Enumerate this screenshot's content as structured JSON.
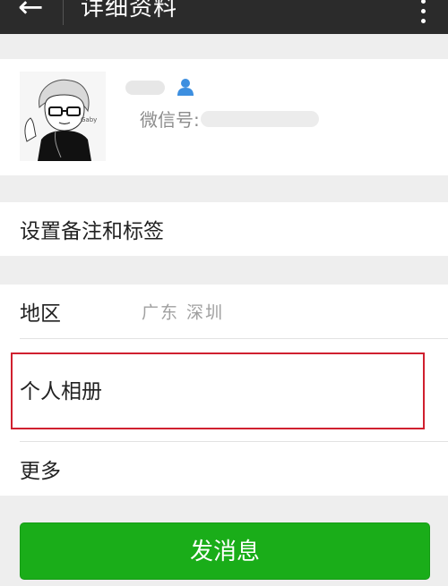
{
  "header": {
    "back_icon": "arrow-left-icon",
    "title": "详细资料",
    "more_icon": "vertical-dots-icon",
    "background": "#2b2b2b"
  },
  "profile": {
    "wechat_id_label": "微信号:",
    "contact_icon": "person-icon",
    "contact_icon_color": "#3d8fe0"
  },
  "rows": {
    "remark_label": "设置备注和标签",
    "region_label": "地区",
    "region_value": "广东  深圳",
    "album_label": "个人相册",
    "more_label": "更多"
  },
  "highlight_color": "#d0202f",
  "send_button": {
    "label": "发消息",
    "color": "#1aad19"
  }
}
